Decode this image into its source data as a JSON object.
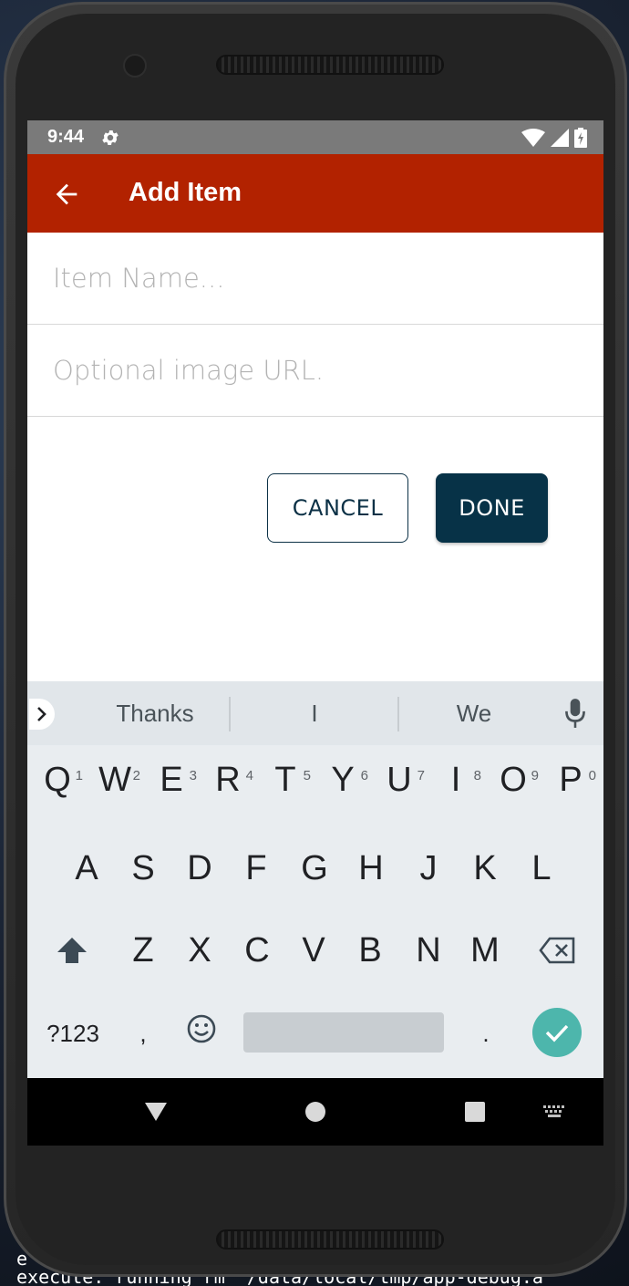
{
  "statusbar": {
    "time": "9:44"
  },
  "appbar": {
    "title": "Add Item"
  },
  "form": {
    "name_value": "",
    "name_placeholder": "Item Name...",
    "url_value": "",
    "url_placeholder": "Optional image URL."
  },
  "actions": {
    "cancel_label": "CANCEL",
    "done_label": "DONE"
  },
  "keyboard": {
    "suggestions": [
      "Thanks",
      "I",
      "We"
    ],
    "row1": [
      {
        "key": "Q",
        "hint": "1"
      },
      {
        "key": "W",
        "hint": "2"
      },
      {
        "key": "E",
        "hint": "3"
      },
      {
        "key": "R",
        "hint": "4"
      },
      {
        "key": "T",
        "hint": "5"
      },
      {
        "key": "Y",
        "hint": "6"
      },
      {
        "key": "U",
        "hint": "7"
      },
      {
        "key": "I",
        "hint": "8"
      },
      {
        "key": "O",
        "hint": "9"
      },
      {
        "key": "P",
        "hint": "0"
      }
    ],
    "row2": [
      "A",
      "S",
      "D",
      "F",
      "G",
      "H",
      "J",
      "K",
      "L"
    ],
    "row3": [
      "Z",
      "X",
      "C",
      "V",
      "B",
      "N",
      "M"
    ],
    "symbols_label": "?123",
    "comma": ",",
    "period": "."
  },
  "colors": {
    "appbar": "#b22200",
    "done_button": "#073247",
    "enter_key": "#4db6ac"
  },
  "terminal": {
    "line1": "e",
    "line2": "execute: running rm \"/data/local/tmp/app-debug.a"
  }
}
